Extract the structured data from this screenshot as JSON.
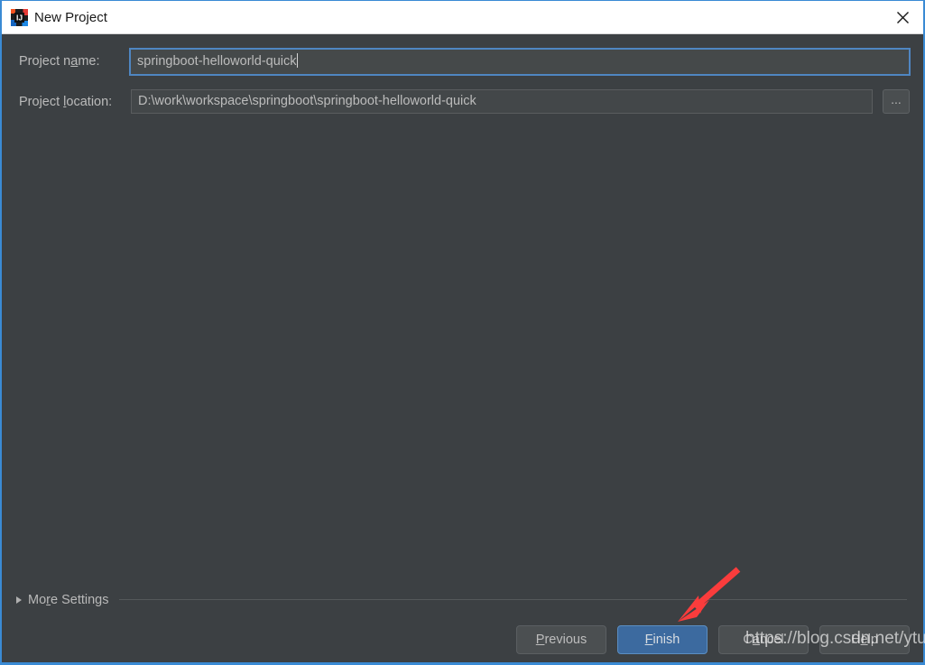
{
  "window": {
    "title": "New Project",
    "icon": "intellij-idea-icon",
    "close_icon": "close-icon",
    "accent_border": "#3a8ad4",
    "background": "#3c4043"
  },
  "form": {
    "fields": [
      {
        "label_before": "Project n",
        "label_mnemonic": "a",
        "label_after": "me:",
        "value": "springboot-helloworld-quick",
        "focused": true,
        "has_browse": false
      },
      {
        "label_before": "Project ",
        "label_mnemonic": "l",
        "label_after": "ocation:",
        "value": "D:\\work\\workspace\\springboot\\springboot-helloworld-quick",
        "focused": false,
        "has_browse": true,
        "browse_label": "..."
      }
    ]
  },
  "more_settings": {
    "label_before": "Mo",
    "label_mnemonic": "r",
    "label_after": "e Settings",
    "expanded": false,
    "triangle_icon": "chevron-right-icon"
  },
  "footer": {
    "buttons": [
      {
        "before": "",
        "mnemonic": "P",
        "after": "revious",
        "primary": false,
        "name": "previous-button"
      },
      {
        "before": "",
        "mnemonic": "F",
        "after": "inish",
        "primary": true,
        "name": "finish-button"
      },
      {
        "before": "C",
        "mnemonic": "a",
        "after": "ncel",
        "primary": false,
        "name": "cancel-button"
      },
      {
        "before": "H",
        "mnemonic": "e",
        "after": "lp",
        "primary": false,
        "name": "help-button"
      }
    ]
  },
  "annotation": {
    "arrow_color": "#fa3c3c",
    "watermark": "https://blog.csdn.net/ytuglt"
  }
}
